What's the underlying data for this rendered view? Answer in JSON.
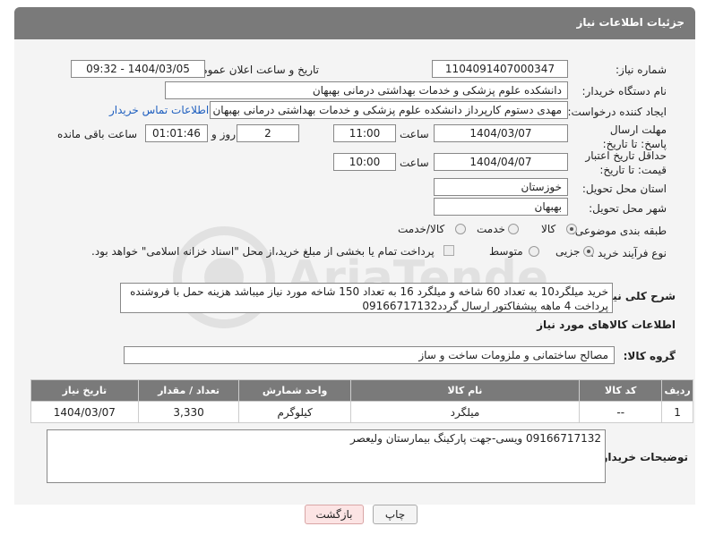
{
  "header": {
    "title": "جزئیات اطلاعات نیاز"
  },
  "fields": {
    "need_number": {
      "label": "شماره نیاز:",
      "value": "1104091407000347"
    },
    "announce": {
      "label": "تاریخ و ساعت اعلان عمومی:",
      "value": "1404/03/05 - 09:32"
    },
    "buyer_org": {
      "label": "نام دستگاه خریدار:",
      "value": "دانشکده علوم پزشکی و خدمات بهداشتی  درمانی بهبهان"
    },
    "creator": {
      "label": "ایجاد کننده درخواست:",
      "value": "مهدی دستوم کارپرداز دانشکده علوم پزشکی و خدمات بهداشتی  درمانی بهبهان",
      "contact_link": "اطلاعات تماس خریدار"
    },
    "reply_deadline": {
      "label": "مهلت ارسال پاسخ: تا تاریخ:",
      "date": "1404/03/07",
      "time_label": "ساعت",
      "time": "11:00",
      "days": "2",
      "days_label": "روز و",
      "remaining": "01:01:46",
      "remaining_label": "ساعت باقی مانده"
    },
    "price_validity": {
      "label": "حداقل تاریخ اعتبار قیمت: تا تاریخ:",
      "date": "1404/04/07",
      "time_label": "ساعت",
      "time": "10:00"
    },
    "province": {
      "label": "استان محل تحویل:",
      "value": "خوزستان"
    },
    "city": {
      "label": "شهر محل تحویل:",
      "value": "بهبهان"
    },
    "category": {
      "label": "طبقه بندی موضوعی:",
      "options": [
        "کالا",
        "خدمت",
        "کالا/خدمت"
      ],
      "selected": "کالا"
    },
    "process": {
      "label": "نوع فرآیند خرید :",
      "options": [
        "جزیی",
        "متوسط"
      ],
      "selected": "جزیی",
      "note": "پرداخت تمام یا بخشی از مبلغ خرید،از محل \"اسناد خزانه اسلامی\" خواهد بود."
    }
  },
  "description": {
    "label": "شرح کلی نیاز:",
    "value": "خرید میلگرد10 به تعداد 60 شاخه و میلگرد 16 به تعداد 150 شاخه مورد نیاز میباشد هزینه حمل با فروشنده پرداخت 4 ماهه پیشفاکتور ارسال گردد09166717132"
  },
  "goods_info": {
    "title": "اطلاعات کالاهای مورد نیاز",
    "group_label": "گروه کالا:",
    "group_value": "مصالح ساختمانی و ملزومات ساخت و ساز"
  },
  "table": {
    "headers": [
      "ردیف",
      "کد کالا",
      "نام کالا",
      "واحد شمارش",
      "تعداد / مقدار",
      "تاریخ نیاز"
    ],
    "rows": [
      [
        "1",
        "--",
        "میلگرد",
        "کیلوگرم",
        "3,330",
        "1404/03/07"
      ]
    ]
  },
  "buyer_notes": {
    "label": "توضیحات خریدار:",
    "value": "09166717132 ویسی-جهت پارکینگ بیمارستان ولیعصر"
  },
  "buttons": {
    "print": "چاپ",
    "back": "بازگشت"
  },
  "watermark": {
    "text": "AriaTender.neT"
  }
}
